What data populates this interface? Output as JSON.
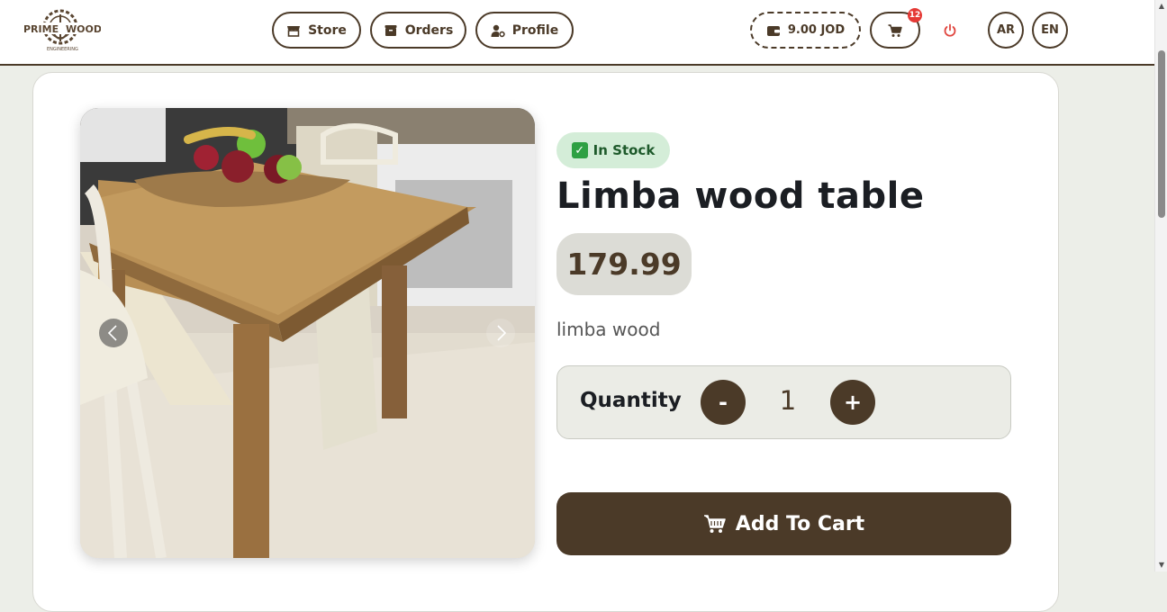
{
  "brand": {
    "name_left": "PRIME",
    "name_right": "WOOD",
    "tagline": "ENGINEERING"
  },
  "nav": {
    "store_label": "Store",
    "orders_label": "Orders",
    "profile_label": "Profile",
    "wallet_balance": "9.00 JOD",
    "cart_count": "12",
    "lang_ar": "AR",
    "lang_en": "EN"
  },
  "product": {
    "stock_status": "In Stock",
    "stock_check_icon": "✓",
    "title": "Limba wood table",
    "price": "179.99",
    "description": "limba wood",
    "quantity_label": "Quantity",
    "quantity": "1",
    "minus_label": "-",
    "plus_label": "+",
    "add_to_cart_label": "Add To Cart"
  },
  "icons": {
    "store": "store-icon",
    "orders": "orders-icon",
    "profile": "user-gear-icon",
    "wallet": "wallet-icon",
    "cart": "cart-icon",
    "power": "power-icon",
    "prev": "chevron-left-icon",
    "next": "chevron-right-icon"
  },
  "colors": {
    "brand_brown": "#4b3a28",
    "stock_green_bg": "#d4edd8",
    "stock_green_text": "#1e5a2b",
    "badge_red": "#e53935",
    "power_red": "#e0463f"
  }
}
